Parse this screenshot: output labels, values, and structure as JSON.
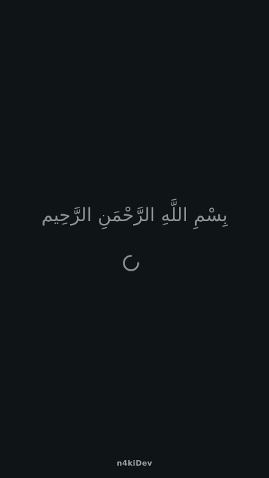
{
  "splash": {
    "basmala": "بِسْمِ اللَّهِ الرَّحْمَنِ الرَّحِيم",
    "developer": "n4kiDev"
  },
  "icons": {
    "loader": "loading-spinner-icon"
  },
  "colors": {
    "background": "#0f1416",
    "text": "#8c9295",
    "spinner": "#8a9194"
  }
}
